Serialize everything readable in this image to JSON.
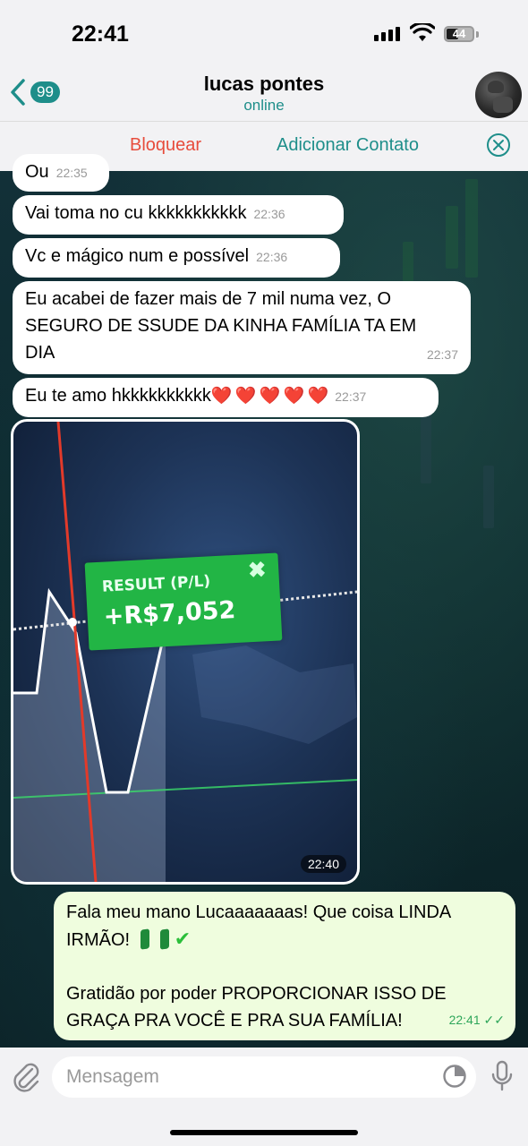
{
  "status_bar": {
    "time": "22:41",
    "battery": "44"
  },
  "header": {
    "back_badge": "99",
    "contact_name": "lucas pontes",
    "contact_status": "online"
  },
  "action_bar": {
    "block_label": "Bloquear",
    "add_contact_label": "Adicionar Contato"
  },
  "messages": [
    {
      "text": "Ou",
      "time": "22:35"
    },
    {
      "text": "Vai toma no cu kkkkkkkkkkk",
      "time": "22:36"
    },
    {
      "text": "Vc e mágico num e possível",
      "time": "22:36"
    },
    {
      "text": "Eu acabei de fazer mais de 7 mil numa vez, O\nSEGURO DE SSUDE DA KINHA FAMÍLIA TA EM\nDIA",
      "time": "22:37"
    },
    {
      "text": "Eu te amo hkkkkkkkkkk",
      "hearts": "❤️ ❤️ ❤️ ❤️ ❤️",
      "time": "22:37"
    }
  ],
  "image_message": {
    "time": "22:40",
    "result_label": "RESULT (P/L)",
    "result_value": "+R$7,052"
  },
  "outgoing": {
    "line1": "Fala meu mano Lucaaaaaaas! Que coisa LINDA",
    "line2": "IRMÃO!",
    "line3": "Gratidão por poder PROPORCIONAR ISSO DE",
    "line4": "GRAÇA PRA VOCÊ E PRA SUA FAMÍLIA!",
    "time": "22:41",
    "check_mark": "✔",
    "read_receipt": "✓✓"
  },
  "input": {
    "placeholder": "Mensagem"
  },
  "colors": {
    "accent": "#1e8e8a",
    "danger": "#e74c3c",
    "outgoing_bubble": "#effdde"
  }
}
